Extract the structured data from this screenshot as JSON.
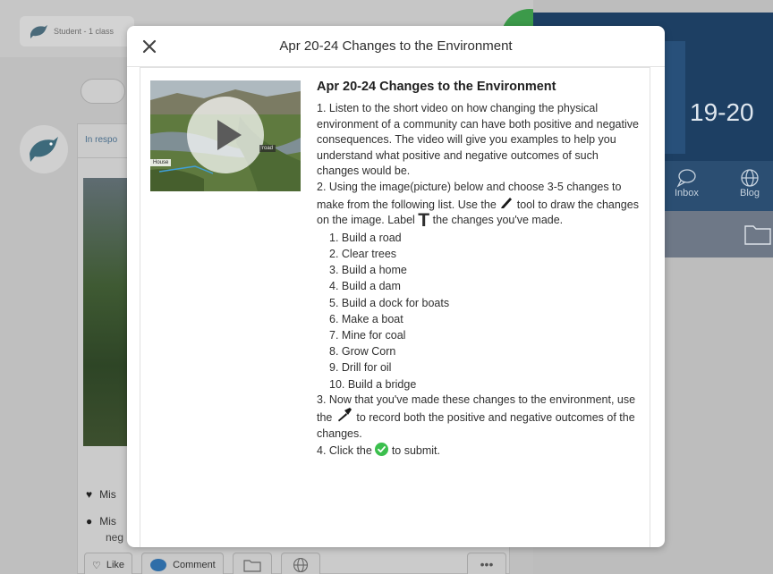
{
  "background": {
    "student_label": "Student - 1 class",
    "post_header": "In respo",
    "like_label_top": "Lik",
    "meta1": "Mis",
    "meta2": "Mis",
    "meta2b": "neg",
    "like_label": "Like",
    "comment_label": "Comment",
    "more_label": "•••",
    "year_text": "19-20",
    "nav_inbox": "Inbox",
    "nav_blog": "Blog"
  },
  "modal": {
    "title": "Apr 20-24 Changes to the Environment",
    "thumbnail_labels": {
      "house": "House",
      "road": "road"
    },
    "content": {
      "heading": "Apr 20-24 Changes to the Environment",
      "para1": "1. Listen to the short video on how changing the physical environment of a community can have both positive and negative consequences. The video will give you examples to help you understand what positive and negative outcomes of such changes would be.",
      "para2_a": "2. Using the image(picture) below and choose 3-5 changes to make from the following list. Use the",
      "para2_b": "tool to draw the changes on the image. Label",
      "para2_T": "T",
      "para2_c": "the changes you've made.",
      "steps": [
        "1. Build a road",
        "2. Clear trees",
        "3. Build a home",
        "4. Build a dam",
        "5. Build a dock for boats",
        "6. Make a boat",
        "7. Mine for coal",
        "8. Grow Corn",
        "9. Drill for oil",
        "10. Build a bridge"
      ],
      "para3_a": "3. Now that you've made these changes to the environment, use the",
      "para3_b": "to record both the positive and negative outcomes of the changes.",
      "para4_a": "4. Click the",
      "para4_b": "to submit."
    }
  },
  "colors": {
    "accent_green": "#3bbf4d",
    "header_blue": "#1d3f63"
  },
  "icons": [
    "close-icon",
    "play-icon",
    "pencil-icon",
    "text-tool-icon",
    "microphone-icon",
    "check-circle-icon",
    "heart-icon",
    "comment-icon",
    "folder-icon",
    "globe-icon",
    "inbox-icon",
    "dolphin-icon"
  ]
}
